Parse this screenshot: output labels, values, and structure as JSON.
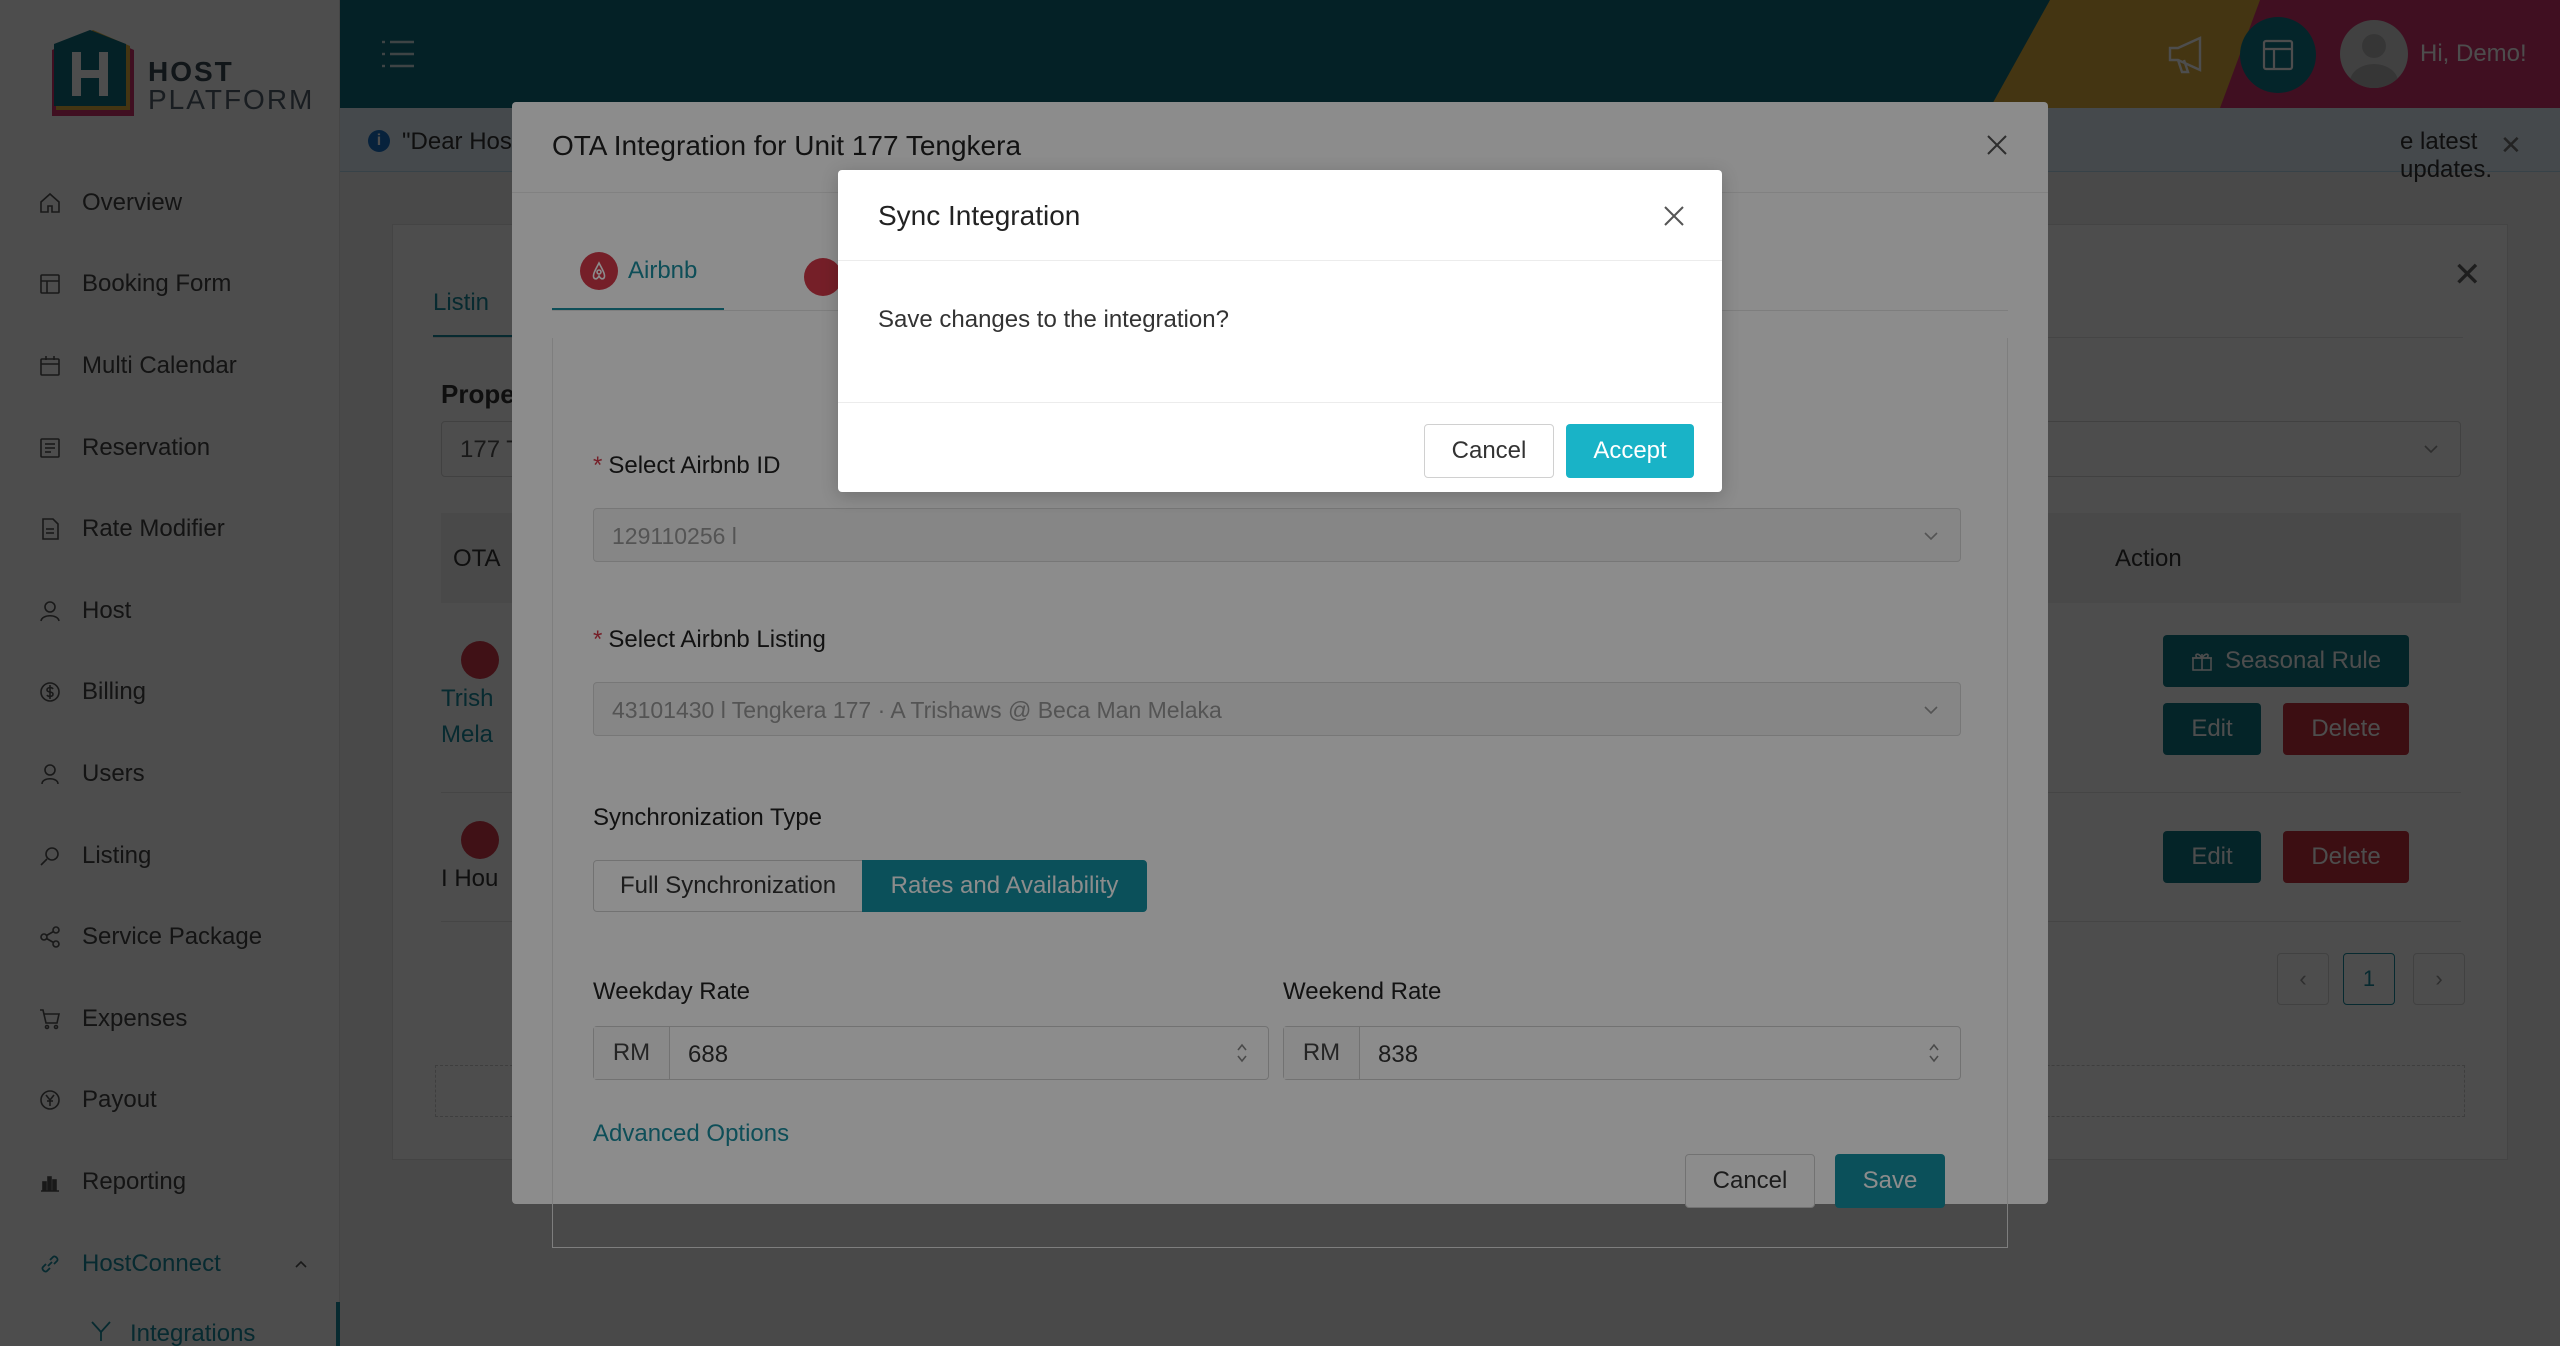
{
  "app": {
    "logo_line1": "HOST",
    "logo_line2": "PLATFORM",
    "greeting": "Hi, Demo!"
  },
  "sidebar": {
    "items": [
      {
        "label": "Overview",
        "icon": "home-icon"
      },
      {
        "label": "Booking Form",
        "icon": "form-icon"
      },
      {
        "label": "Multi Calendar",
        "icon": "calendar-icon"
      },
      {
        "label": "Reservation",
        "icon": "list-icon"
      },
      {
        "label": "Rate Modifier",
        "icon": "document-icon"
      },
      {
        "label": "Host",
        "icon": "host-icon"
      },
      {
        "label": "Billing",
        "icon": "billing-icon"
      },
      {
        "label": "Users",
        "icon": "user-icon"
      },
      {
        "label": "Listing",
        "icon": "search-icon"
      },
      {
        "label": "Service Package",
        "icon": "share-icon"
      },
      {
        "label": "Expenses",
        "icon": "cart-icon"
      },
      {
        "label": "Payout",
        "icon": "yen-icon"
      },
      {
        "label": "Reporting",
        "icon": "chart-icon"
      },
      {
        "label": "HostConnect",
        "icon": "link-icon"
      }
    ],
    "sub_item": "Integrations"
  },
  "notice": {
    "text_start": "\"Dear Hos",
    "text_end": "e latest updates."
  },
  "background_card": {
    "tab": "Listin",
    "property_label": "Prope",
    "property_value": "177 T",
    "col_ota": "OTA",
    "col_action": "Action",
    "row1_text_a": "Trish",
    "row1_text_b": "Mela",
    "row2_text": "I Hou",
    "seasonal_rule": "Seasonal Rule",
    "edit": "Edit",
    "delete": "Delete",
    "page": "1"
  },
  "ota_modal": {
    "title": "OTA Integration for Unit 177 Tengkera",
    "tab_airbnb": "Airbnb",
    "airbnb_id_label": "Select Airbnb ID",
    "airbnb_id_value": "129110256 l",
    "airbnb_listing_label": "Select Airbnb Listing",
    "airbnb_listing_value": "43101430 l Tengkera 177 · A Trishaws @ Beca Man Melaka",
    "sync_type_label": "Synchronization Type",
    "sync_full": "Full Synchronization",
    "sync_rates": "Rates and Availability",
    "weekday_label": "Weekday Rate",
    "weekend_label": "Weekend Rate",
    "currency": "RM",
    "weekday_value": "688",
    "weekend_value": "838",
    "advanced": "Advanced Options",
    "cancel": "Cancel",
    "save": "Save"
  },
  "sync_modal": {
    "title": "Sync Integration",
    "message": "Save changes to the integration?",
    "cancel": "Cancel",
    "accept": "Accept"
  },
  "colors": {
    "header": "#0f6e80",
    "primary": "#1593a5",
    "accept": "#19b3c7",
    "danger": "#c9303c"
  }
}
